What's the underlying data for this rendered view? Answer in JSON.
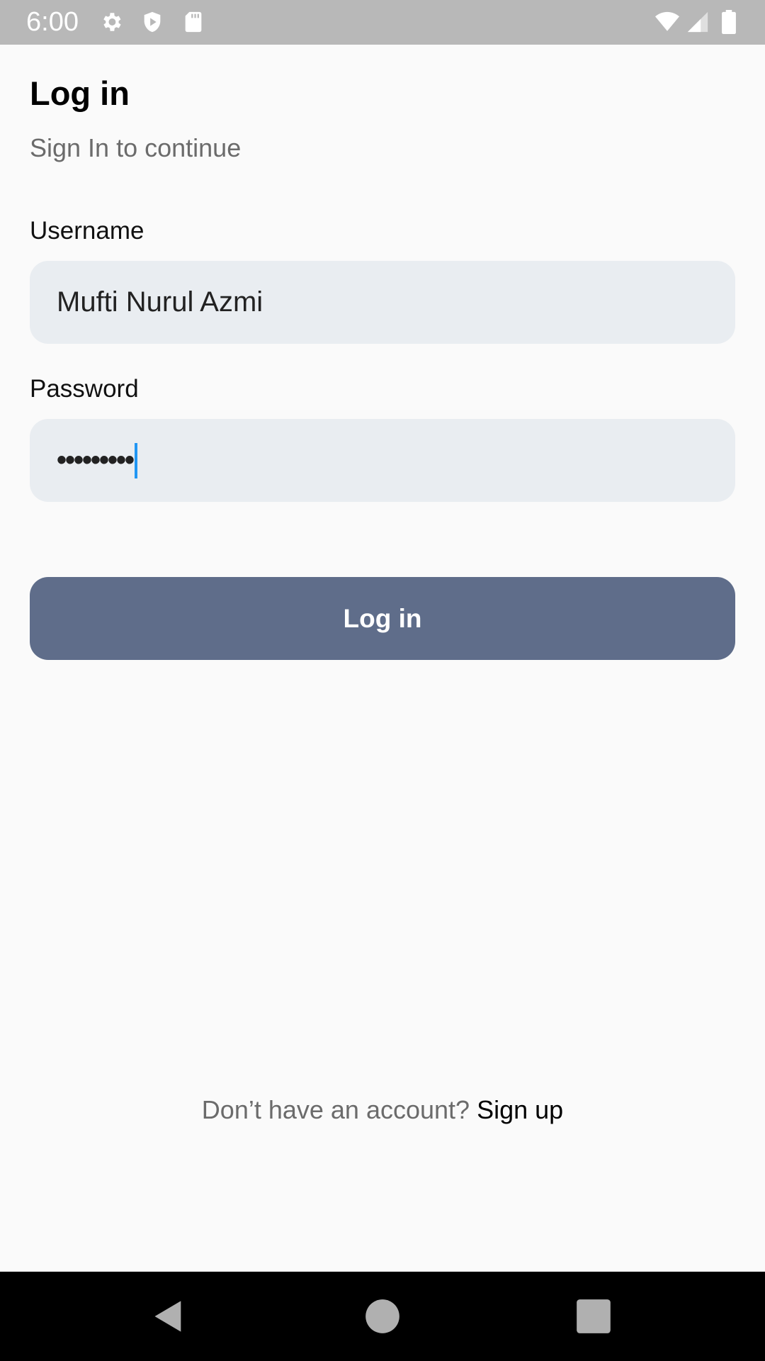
{
  "status_bar": {
    "time": "6:00",
    "icons": [
      "gear-icon",
      "shield-icon",
      "sd-card-icon",
      "wifi-icon",
      "signal-icon",
      "battery-icon"
    ]
  },
  "header": {
    "title": "Log in",
    "subtitle": "Sign In to continue"
  },
  "form": {
    "username_label": "Username",
    "username_value": "Mufti Nurul Azmi",
    "password_label": "Password",
    "password_value": "•••••••••",
    "submit_label": "Log in"
  },
  "footer": {
    "prompt": "Don’t have an account?",
    "link": "Sign up"
  },
  "nav_bar": {
    "buttons": [
      "back-icon",
      "home-icon",
      "recents-icon"
    ]
  },
  "colors": {
    "status_bar": "#b8b8b8",
    "background": "#fafafa",
    "input_background": "#e9edf1",
    "button": "#5f6d8a",
    "cursor": "#2196f3"
  }
}
